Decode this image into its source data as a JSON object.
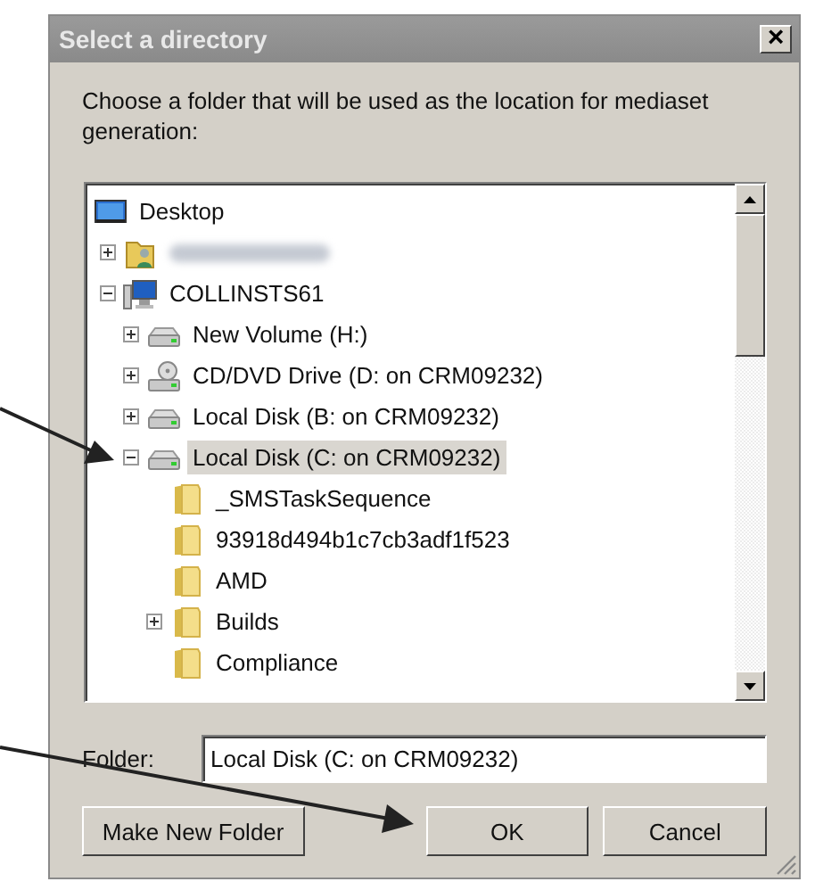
{
  "window": {
    "title": "Select a directory",
    "close": "×"
  },
  "instructions": "Choose a folder that will be used as the location for mediaset generation:",
  "tree": [
    {
      "kind": "desktop",
      "label": "Desktop",
      "selected": false,
      "children": [
        {
          "kind": "user",
          "expanded": false,
          "selected": false
        },
        {
          "kind": "computer",
          "label": "COLLINSTS61",
          "expanded": true,
          "selected": false,
          "children": [
            {
              "kind": "drive",
              "label": "New Volume (H:)",
              "expanded": false,
              "selected": false
            },
            {
              "kind": "cd",
              "label": "CD/DVD Drive (D: on CRM09232)",
              "expanded": false,
              "selected": false
            },
            {
              "kind": "drive",
              "label": "Local Disk (B: on CRM09232)",
              "expanded": false,
              "selected": false
            },
            {
              "kind": "drive",
              "label": "Local Disk (C: on CRM09232)",
              "expanded": true,
              "selected": true,
              "children": [
                {
                  "kind": "folder",
                  "label": "_SMSTaskSequence",
                  "selected": false
                },
                {
                  "kind": "folder",
                  "label": "93918d494b1c7cb3adf1f523",
                  "selected": false
                },
                {
                  "kind": "folder",
                  "label": "AMD",
                  "selected": false
                },
                {
                  "kind": "folder",
                  "label": "Builds",
                  "expanded": false,
                  "selected": false
                },
                {
                  "kind": "folder",
                  "label": "Compliance",
                  "selected": false
                }
              ]
            }
          ]
        }
      ]
    }
  ],
  "folder_field": {
    "label": "Folder:",
    "value": "Local Disk (C: on CRM09232)"
  },
  "buttons": [
    {
      "label": "Make New Folder"
    },
    {
      "label": "OK"
    },
    {
      "label": "Cancel"
    }
  ]
}
